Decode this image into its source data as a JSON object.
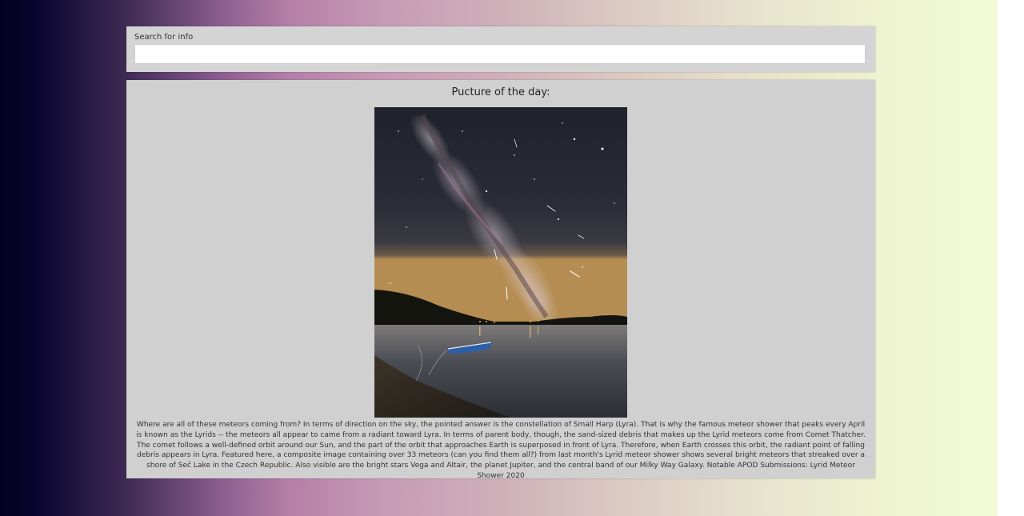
{
  "search": {
    "label": "Search for info",
    "value": "",
    "placeholder": ""
  },
  "picture": {
    "title": "Pucture of the day:",
    "description": "Where are all of these meteors coming from? In terms of direction on the sky, the pointed answer is the constellation of Small Harp (Lyra). That is why the famous meteor shower that peaks every April is known as the Lyrids -- the meteors all appear to came from a radiant toward Lyra. In terms of parent body, though, the sand-sized debris that makes up the Lyrid meteors come from Comet Thatcher. The comet follows a well-defined orbit around our Sun, and the part of the orbit that approaches Earth is superposed in front of Lyra. Therefore, when Earth crosses this orbit, the radiant point of falling debris appears in Lyra. Featured here, a composite image containing over 33 meteors (can you find them all?) from last month's Lyrid meteor shower shows several bright meteors that streaked over a shore of Seč Lake in the Czech Republic. Also visible are the bright stars Vega and Altair, the planet Jupiter, and the central band of our Milky Way Galaxy. Notable APOD Submissions: Lyrid Meteor Shower 2020"
  },
  "colors": {
    "panel": "#d0d0d0",
    "search_panel": "#d4d4d4",
    "gradient_start": "#020020",
    "gradient_mid": "#b57fa8",
    "gradient_end": "#f2fbd6"
  }
}
